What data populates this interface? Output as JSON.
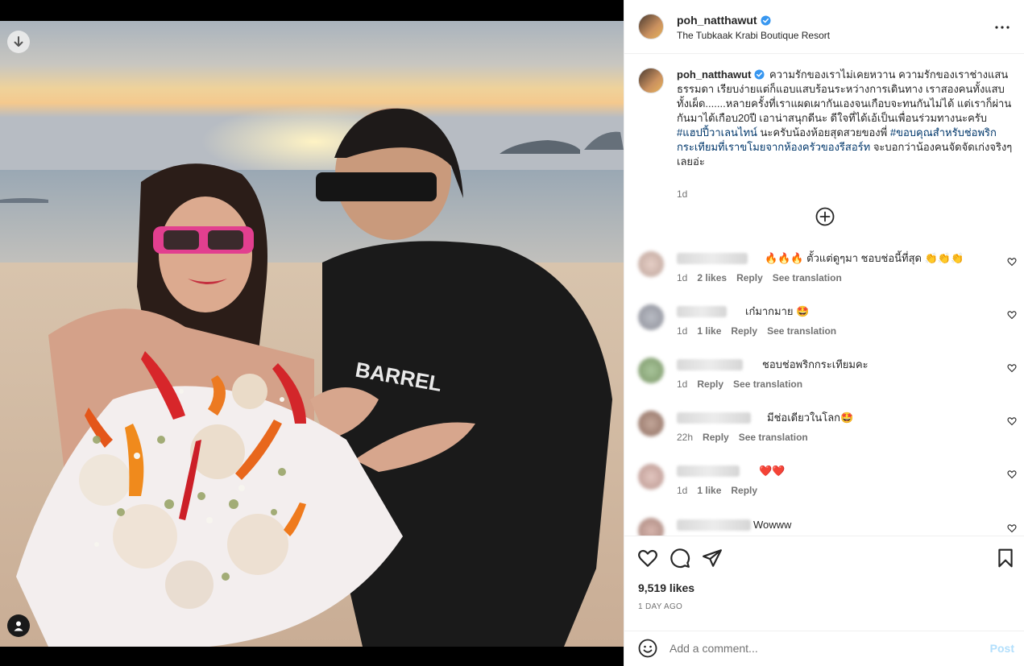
{
  "post": {
    "username": "poh_natthawut",
    "location": "The Tubkaak Krabi Boutique Resort"
  },
  "caption": {
    "username": "poh_natthawut",
    "text_1": " ความรักของเราไม่เคยหวาน ความรักของเราช่างแสนธรรมดา เรียบง่ายแต่ก็แอบแสบร้อนระหว่างการเดินทาง เราสองคนทั้งแสบทั้งเผ็ด.......หลายครั้งที่เราแผดเผากันเองจนเกือบจะทนกันไม่ได้ แต่เราก็ผ่านกันมาได้เกือบ20ปี เอาน่าสนุกดีนะ ดีใจที่ได้เอ้เป็นเพื่อนร่วมทางนะครับ ",
    "hashtag_1": "#แฮปปี้วาเลนไทน์",
    "text_2": " นะครับน้องห้อยสุดสวยของพี่ ",
    "hashtag_2": "#ขอบคุณสำหรับช่อพริกกระเทียมที่เราขโมยจากห้องครัวของรีสอร์ท",
    "text_3": " จะบอกว่าน้องคนจัดจัดเก่งจริงๆเลยอ่ะ",
    "time": "1d"
  },
  "comments": [
    {
      "text": "🔥🔥🔥 ตั้วแต่ดูๆมา ชอบช่อนี้ที่สุด 👏👏👏",
      "time": "1d",
      "likes": "2 likes",
      "reply": "Reply",
      "translate": "See translation"
    },
    {
      "text": "เก๋มากมาย 🤩",
      "time": "1d",
      "likes": "1 like",
      "reply": "Reply",
      "translate": "See translation"
    },
    {
      "text": "ชอบช่อพริกกระเทียมคะ",
      "time": "1d",
      "likes": "",
      "reply": "Reply",
      "translate": "See translation"
    },
    {
      "text": "มีช่อเดียวในโลก🤩",
      "time": "22h",
      "likes": "",
      "reply": "Reply",
      "translate": "See translation"
    },
    {
      "text": "❤️❤️",
      "time": "1d",
      "likes": "1 like",
      "reply": "Reply",
      "translate": ""
    },
    {
      "text": "Wowww",
      "time": "",
      "likes": "",
      "reply": "",
      "translate": ""
    }
  ],
  "stats": {
    "likes": "9,519 likes",
    "ago": "1 DAY AGO"
  },
  "composer": {
    "placeholder": "Add a comment...",
    "post_label": "Post"
  },
  "colors": {
    "link": "#00376b",
    "verified": "#3897f0",
    "post_disabled": "#b2dffc"
  }
}
